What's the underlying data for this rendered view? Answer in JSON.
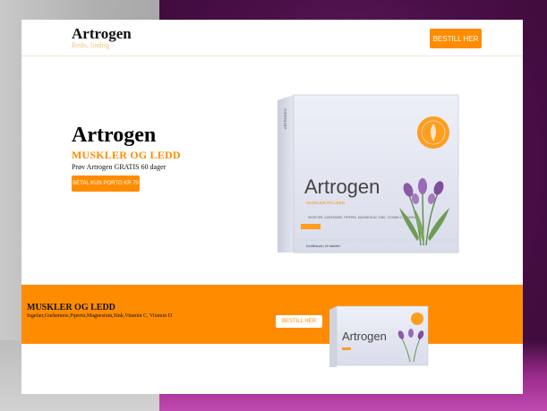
{
  "header": {
    "brand": "Artrogen",
    "tagline": "Redo, lindrig",
    "order_button": "BESTILL HER"
  },
  "hero": {
    "title": "Artrogen",
    "subtitle": "MUSKLER OG LEDD",
    "text": "Prøv Artrogen GRATIS 60 dager",
    "pay_button": "BETAL KUN PORTO KR 79"
  },
  "product_box": {
    "name": "Artrogen",
    "subtitle": "MUSKLER OG LEDD",
    "ingredients": "INGEFÆR, GURKEMEIE, PIPERIN, MAGNESIUM, SINK, VITAMIN C, VITAMIN D",
    "footer": "Kosttilskudd | 60 tabletter",
    "side_text": "ARTROGEN"
  },
  "band": {
    "title": "MUSKLER OG LEDD",
    "ingredients": "Ingefær,Gurkemeie,Piperin,Magnesium,Sink,Vitamin C, Vitamin D",
    "button": "BESTILL HER"
  },
  "colors": {
    "accent": "#ff8c00",
    "background_left": "#b0b0b0",
    "background_right": "#4a0f47"
  }
}
